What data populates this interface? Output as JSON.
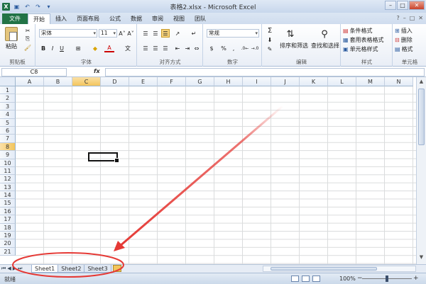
{
  "window": {
    "title": "表格2.xlsx - Microsoft Excel"
  },
  "qat": [
    "excel-logo-icon",
    "save-icon",
    "undo-icon",
    "redo-icon"
  ],
  "tabs": [
    "文件",
    "开始",
    "插入",
    "页面布局",
    "公式",
    "数据",
    "审阅",
    "视图",
    "团队"
  ],
  "ribbon": {
    "clipboard": {
      "label": "剪贴板",
      "paste": "粘贴"
    },
    "font": {
      "label": "字体",
      "font_name": "宋体",
      "font_size": "11",
      "bold": "B",
      "italic": "I",
      "underline": "U"
    },
    "alignment": {
      "label": "对齐方式"
    },
    "number": {
      "label": "数字",
      "format": "常规",
      "currency": "$",
      "percent": "%",
      "comma": ","
    },
    "editing": {
      "label": "编辑",
      "sort_filter": "排序和筛选",
      "find_select": "查找和选择",
      "sum": "Σ"
    },
    "styles": {
      "label": "样式",
      "conditional": "条件格式",
      "table_format": "套用表格格式",
      "cell_styles": "单元格样式"
    },
    "cells": {
      "label": "单元格",
      "insert": "插入",
      "delete": "删除",
      "format": "格式"
    }
  },
  "formula_bar": {
    "name_box": "C8",
    "fx": "fx",
    "value": ""
  },
  "grid": {
    "columns": [
      "A",
      "B",
      "C",
      "D",
      "E",
      "F",
      "G",
      "H",
      "I",
      "J",
      "K",
      "L",
      "M",
      "N"
    ],
    "rows": [
      "1",
      "2",
      "3",
      "4",
      "5",
      "6",
      "7",
      "8",
      "9",
      "10",
      "11",
      "12",
      "13",
      "14",
      "15",
      "16",
      "17",
      "18",
      "19",
      "20",
      "21"
    ],
    "selected_cell": "C8"
  },
  "sheets": [
    "Sheet1",
    "Sheet2",
    "Sheet3"
  ],
  "active_sheet": "Sheet1",
  "status": {
    "mode": "就绪",
    "zoom": "100%"
  },
  "annotation_color": "#e53935"
}
